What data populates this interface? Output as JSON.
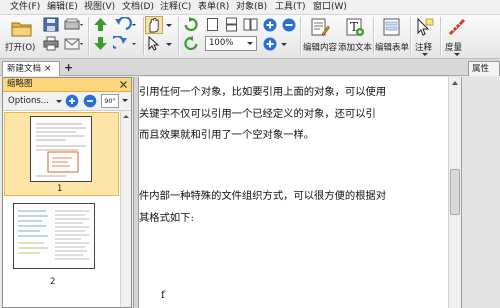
{
  "menu": [
    {
      "label": "文件(F)"
    },
    {
      "label": "编辑(E)"
    },
    {
      "label": "视图(V)"
    },
    {
      "label": "文档(D)"
    },
    {
      "label": "注释(C)"
    },
    {
      "label": "表单(R)"
    },
    {
      "label": "对象(B)"
    },
    {
      "label": "工具(T)"
    },
    {
      "label": "窗口(W)"
    }
  ],
  "toolbar": {
    "open_label": "打开(O)",
    "zoom_value": "100%",
    "edit_content_label": "编辑内容",
    "add_text_label": "添加文本",
    "edit_form_label": "编辑表单",
    "comment_label": "注释",
    "measure_label": "度量"
  },
  "tabs": {
    "doc_tab": "新建文档",
    "close_glyph": "×",
    "add_glyph": "+",
    "properties_tab": "属性"
  },
  "thumbnails": {
    "header": "缩略图",
    "options_label": "Options...",
    "rotate_label": "90°",
    "pages": [
      {
        "number": "1"
      },
      {
        "number": "2"
      }
    ]
  },
  "document": {
    "lines": [
      "引用任何一个对象，比如要引用上面的对象，可以使用",
      "关键字不仅可以引用一个已经定义的对象，还可以引",
      "而且效果就和引用了一个空对象一样。",
      "",
      "件内部一种特殊的文件组织方式，可以很方便的根据对",
      "其格式如下:",
      "f"
    ]
  },
  "colors": {
    "panel_header": "#ffd77a",
    "selected_thumb": "#fde6a8",
    "accent_blue": "#2a6fd6",
    "accent_green": "#3c9a2f"
  }
}
